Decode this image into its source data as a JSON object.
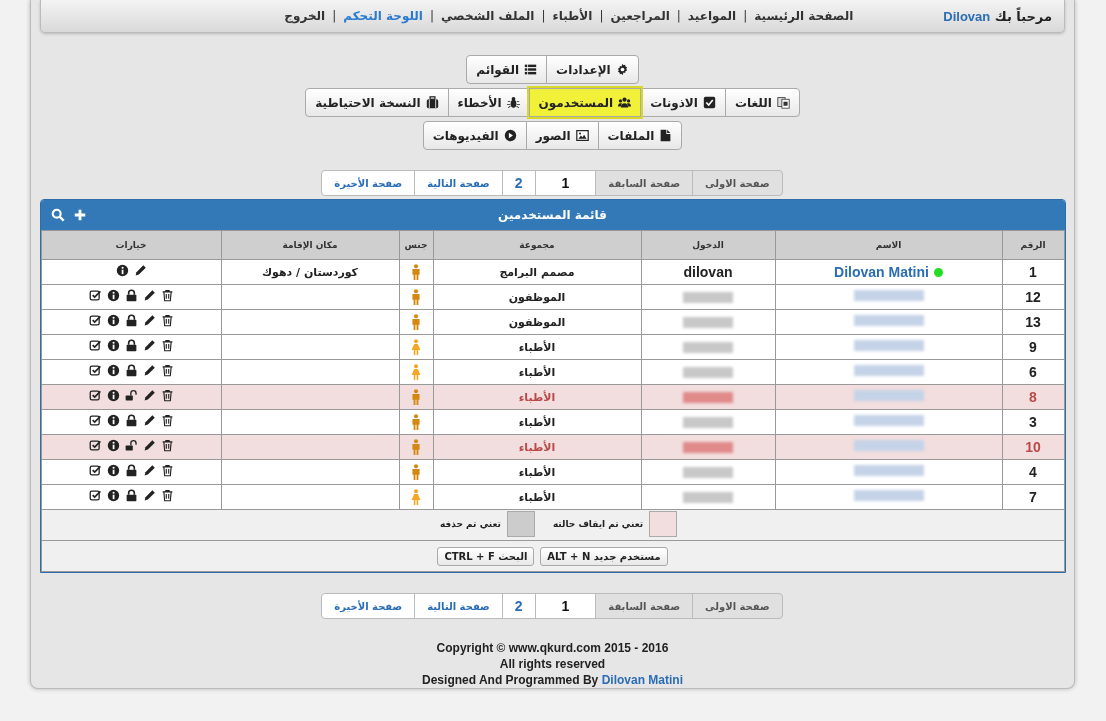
{
  "header": {
    "greeting": "مرحباً بك",
    "user": "Dilovan",
    "separator": "|",
    "nav": [
      {
        "label": "الصفحة الرئيسية",
        "selected": false
      },
      {
        "label": "المواعيد",
        "selected": false
      },
      {
        "label": "المراجعين",
        "selected": false
      },
      {
        "label": "الأطباء",
        "selected": false
      },
      {
        "label": "الملف الشخصي",
        "selected": false
      },
      {
        "label": "اللوحة التحكم",
        "selected": true
      },
      {
        "label": "الخروج",
        "selected": false
      }
    ]
  },
  "menu_rows": [
    [
      {
        "label": "الإعدادات",
        "kind": "gear",
        "selected": false
      },
      {
        "label": "القوائم",
        "kind": "list",
        "selected": false
      }
    ],
    [
      {
        "label": "اللغات",
        "kind": "translate",
        "selected": false
      },
      {
        "label": "الاذونات",
        "kind": "check-square",
        "selected": false
      },
      {
        "label": "المستخدمون",
        "kind": "users",
        "selected": true
      },
      {
        "label": "الأخطاء",
        "kind": "bug",
        "selected": false
      },
      {
        "label": "النسخة الاحتياطية",
        "kind": "suitcase",
        "selected": false
      }
    ],
    [
      {
        "label": "الملفات",
        "kind": "file",
        "selected": false
      },
      {
        "label": "الصور",
        "kind": "image",
        "selected": false
      },
      {
        "label": "الفيديوهات",
        "kind": "play",
        "selected": false
      }
    ]
  ],
  "pagination_top": [
    {
      "label": "صفحة الاولى",
      "kind": "disabled"
    },
    {
      "label": "صفحة السابقة",
      "kind": "disabled"
    },
    {
      "label": "1",
      "kind": "current"
    },
    {
      "label": "2",
      "kind": "link"
    },
    {
      "label": "صفحة التالية",
      "kind": "link"
    },
    {
      "label": "صفحة الأخيرة",
      "kind": "link"
    }
  ],
  "table": {
    "title": "قائمة المستخدمين",
    "columns": [
      "الرقم",
      "الاسم",
      "الدخول",
      "مجموعة",
      "جنس",
      "مكان الإقامة",
      "خيارات"
    ],
    "rows": [
      {
        "number": "1",
        "name": "Dilovan Matini",
        "login": "dilovan",
        "group": "مصمم البرامج",
        "gender": {
          "kind": "male"
        },
        "residence": "كوردستان / دهوك",
        "online": true,
        "blurred": false,
        "suspended": false,
        "kind": "owner"
      },
      {
        "number": "12",
        "group": "الموظفون",
        "gender": {
          "kind": "male"
        },
        "online": false,
        "blurred": true,
        "suspended": false,
        "locked": true,
        "kind": "user"
      },
      {
        "number": "13",
        "group": "الموظفون",
        "gender": {
          "kind": "male"
        },
        "online": false,
        "blurred": true,
        "suspended": false,
        "locked": true,
        "kind": "user"
      },
      {
        "number": "9",
        "group": "الأطباء",
        "gender": {
          "kind": "female"
        },
        "online": false,
        "blurred": true,
        "suspended": false,
        "locked": true,
        "kind": "user"
      },
      {
        "number": "6",
        "group": "الأطباء",
        "gender": {
          "kind": "female"
        },
        "online": false,
        "blurred": true,
        "suspended": false,
        "locked": true,
        "kind": "user"
      },
      {
        "number": "8",
        "group": "الأطباء",
        "gender": {
          "kind": "male"
        },
        "online": false,
        "blurred": true,
        "suspended": true,
        "locked": false,
        "kind": "user"
      },
      {
        "number": "3",
        "group": "الأطباء",
        "gender": {
          "kind": "male"
        },
        "online": false,
        "blurred": true,
        "suspended": false,
        "locked": true,
        "kind": "user"
      },
      {
        "number": "10",
        "group": "الأطباء",
        "gender": {
          "kind": "male"
        },
        "online": false,
        "blurred": true,
        "suspended": true,
        "locked": false,
        "kind": "user"
      },
      {
        "number": "4",
        "group": "الأطباء",
        "gender": {
          "kind": "male"
        },
        "online": false,
        "blurred": true,
        "suspended": false,
        "locked": true,
        "kind": "user"
      },
      {
        "number": "7",
        "group": "الأطباء",
        "gender": {
          "kind": "female"
        },
        "online": false,
        "blurred": true,
        "suspended": false,
        "locked": true,
        "kind": "user"
      }
    ],
    "legend": [
      {
        "label": "تعني تم ايقاف حالته",
        "color": "#f2dede"
      },
      {
        "label": "تعني تم حذفه",
        "color": "#cccccc"
      }
    ],
    "shortcuts": [
      "مستخدم جديد ALT + N",
      "البحث CTRL + F"
    ]
  },
  "pagination_bottom": [
    {
      "label": "صفحة الاولى",
      "kind": "disabled"
    },
    {
      "label": "صفحة السابقة",
      "kind": "disabled"
    },
    {
      "label": "1",
      "kind": "current"
    },
    {
      "label": "2",
      "kind": "link"
    },
    {
      "label": "صفحة التالية",
      "kind": "link"
    },
    {
      "label": "صفحة الأخيرة",
      "kind": "link"
    }
  ],
  "footer": {
    "lines": [
      "Copyright © www.qkurd.com 2015 - 2016",
      "All rights reserved"
    ],
    "designed_by": "Designed And Programmed By",
    "author": "Dilovan Matini"
  }
}
